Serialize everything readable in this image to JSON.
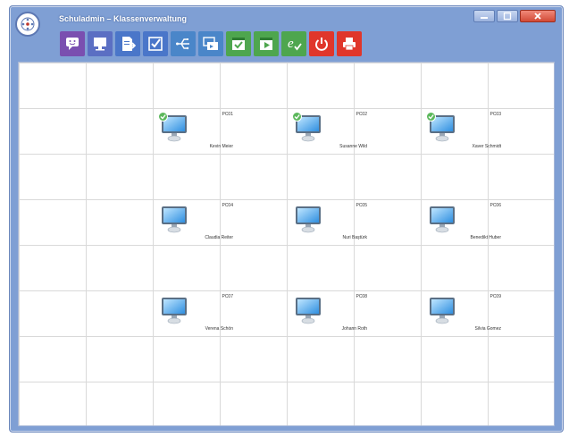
{
  "window": {
    "title": "Schuladmin – Klassenverwaltung"
  },
  "toolbar": {
    "tools": [
      {
        "icon": "chat-icon",
        "color": "#7a4fb0"
      },
      {
        "icon": "monitor-icon",
        "color": "#5b6fc3"
      },
      {
        "icon": "send-document-icon",
        "color": "#4a76c9"
      },
      {
        "icon": "checkbox-icon",
        "color": "#4a76c9"
      },
      {
        "icon": "usb-icon",
        "color": "#4a86c9"
      },
      {
        "icon": "screen-share-icon",
        "color": "#4a86c9"
      },
      {
        "icon": "exam-check-icon",
        "color": "#4ea64e"
      },
      {
        "icon": "presentation-play-icon",
        "color": "#4ea64e"
      },
      {
        "icon": "exam-mode-icon",
        "color": "#4ea64e"
      },
      {
        "icon": "power-icon",
        "color": "#e0362b"
      },
      {
        "icon": "printer-icon",
        "color": "#e0362b"
      }
    ]
  },
  "pcs": [
    {
      "id": "PC01",
      "user": "Kevin Meier",
      "online": true
    },
    {
      "id": "PC02",
      "user": "Susanne Wild",
      "online": true
    },
    {
      "id": "PC03",
      "user": "Xaver Schmidt",
      "online": true
    },
    {
      "id": "PC04",
      "user": "Claudia Reiter",
      "online": false
    },
    {
      "id": "PC05",
      "user": "Nuri Baştürk",
      "online": false
    },
    {
      "id": "PC06",
      "user": "Benedikt Huber",
      "online": false
    },
    {
      "id": "PC07",
      "user": "Verena Schön",
      "online": false
    },
    {
      "id": "PC08",
      "user": "Johann Roth",
      "online": false
    },
    {
      "id": "PC09",
      "user": "Silvia Gomez",
      "online": false
    }
  ]
}
